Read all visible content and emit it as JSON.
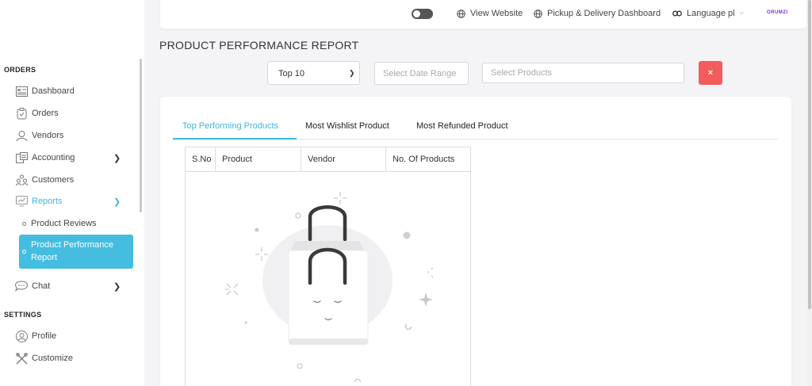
{
  "topbar": {
    "view_website": "View Website",
    "pickup_delivery": "Pickup & Delivery Dashboard",
    "language": "Language pl",
    "brand": "ORUMZI"
  },
  "sidebar": {
    "orders_section": "ORDERS",
    "settings_section": "SETTINGS",
    "items": [
      {
        "label": "Dashboard",
        "icon": "dashboard-icon"
      },
      {
        "label": "Orders",
        "icon": "orders-icon"
      },
      {
        "label": "Vendors",
        "icon": "vendors-icon"
      },
      {
        "label": "Accounting",
        "icon": "accounting-icon"
      },
      {
        "label": "Customers",
        "icon": "customers-icon"
      },
      {
        "label": "Reports",
        "icon": "reports-icon"
      },
      {
        "label": "Chat",
        "icon": "chat-icon"
      },
      {
        "label": "Profile",
        "icon": "profile-icon"
      },
      {
        "label": "Customize",
        "icon": "customize-icon"
      }
    ],
    "sub_items": [
      {
        "label": "Product Reviews"
      },
      {
        "label": "Product Performance Report"
      }
    ]
  },
  "page": {
    "title": "PRODUCT PERFORMANCE REPORT"
  },
  "filters": {
    "top_select": "Top 10",
    "date_placeholder": "Select Date Range",
    "products_placeholder": "Select Products",
    "clear_label": "×"
  },
  "tabs": [
    {
      "label": "Top Performing Products"
    },
    {
      "label": "Most Wishlist Product"
    },
    {
      "label": "Most Refunded Product"
    }
  ],
  "table": {
    "headers": [
      "S.No",
      "Product",
      "Vendor",
      "No. Of Products"
    ]
  },
  "colors": {
    "accent": "#44bde0",
    "danger": "#f25c5c",
    "brand": "#7a2ad9"
  }
}
